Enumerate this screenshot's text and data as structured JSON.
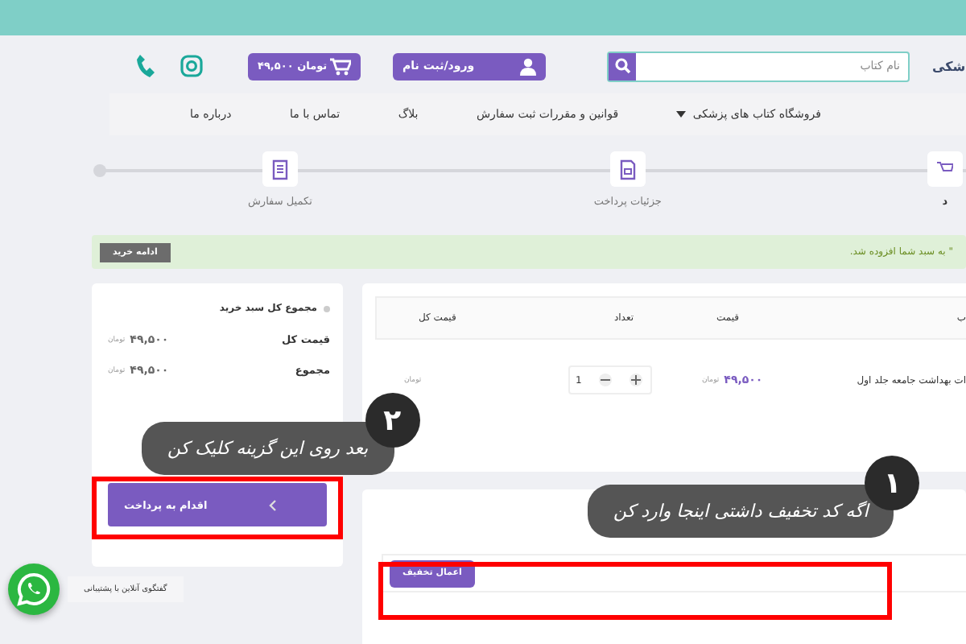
{
  "header": {
    "site_name": "شکی",
    "search": {
      "placeholder": "نام کتاب"
    },
    "login_button": "ورود/ثبت نام",
    "cart_button": "۴۹,۵۰۰ تومان"
  },
  "nav": [
    {
      "label": "فروشگاه کتاب های پزشکی",
      "dropdown": true
    },
    {
      "label": "قوانین و مقررات ثبت سفارش",
      "dropdown": false
    },
    {
      "label": "بلاگ",
      "dropdown": false
    },
    {
      "label": "تماس با ما",
      "dropdown": false
    },
    {
      "label": "درباره ما",
      "dropdown": false
    }
  ],
  "steps": [
    {
      "label": "د",
      "kind": "cart"
    },
    {
      "label": "جزئیات پرداخت",
      "kind": "payment"
    },
    {
      "label": "تکمیل سفارش",
      "kind": "receipt"
    }
  ],
  "alert": {
    "message": "\" به سبد شما افزوده شد.",
    "button": "ادامه خرید"
  },
  "cart_table": {
    "columns": [
      "ب",
      "قیمت",
      "تعداد",
      "قیمت کل"
    ],
    "rows": [
      {
        "product": "ات بهداشت جامعه جلد اول",
        "price": "۴۹,۵۰۰",
        "currency": "تومان",
        "quantity": "1",
        "total_currency": "تومان"
      }
    ]
  },
  "discount": {
    "button": "اعمال تخفیف"
  },
  "summary": {
    "title": "مجموع کل سبد خرید",
    "rows": [
      {
        "label": "قیمت کل",
        "amount": "۴۹,۵۰۰",
        "currency": "تومان"
      },
      {
        "label": "مجموع",
        "amount": "۴۹,۵۰۰",
        "currency": "تومان"
      }
    ],
    "checkout_button": "اقدام به پرداخت"
  },
  "chat": {
    "label": "گفتگوی آنلاین با پشتیبانی"
  },
  "callouts": [
    {
      "number": "۱",
      "text": "اگه کد تخفیف داشتی اینجا وارد کن"
    },
    {
      "number": "۲",
      "text": "بعد روی این گزینه کلیک کن"
    }
  ]
}
